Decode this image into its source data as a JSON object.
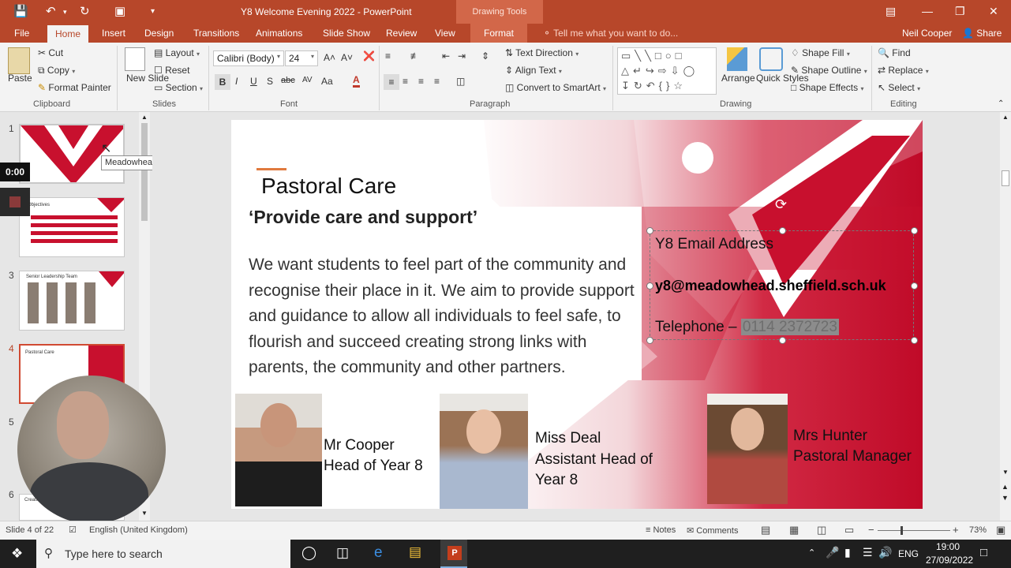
{
  "window": {
    "title": "Y8 Welcome Evening 2022 - PowerPoint",
    "context_tab_group": "Drawing Tools",
    "user": "Neil Cooper",
    "share": "Share"
  },
  "tabs": [
    "File",
    "Home",
    "Insert",
    "Design",
    "Transitions",
    "Animations",
    "Slide Show",
    "Review",
    "View",
    "Format"
  ],
  "tell_me": "Tell me what you want to do...",
  "ribbon": {
    "clipboard": {
      "paste": "Paste",
      "cut": "Cut",
      "copy": "Copy",
      "format_painter": "Format Painter",
      "label": "Clipboard"
    },
    "slides": {
      "new_slide": "New Slide",
      "layout": "Layout",
      "reset": "Reset",
      "section": "Section",
      "label": "Slides"
    },
    "font": {
      "name": "Calibri (Body)",
      "size": "24",
      "label": "Font"
    },
    "paragraph": {
      "text_direction": "Text Direction",
      "align_text": "Align Text",
      "convert": "Convert to SmartArt",
      "label": "Paragraph"
    },
    "drawing": {
      "arrange": "Arrange",
      "quick_styles": "Quick Styles",
      "shape_fill": "Shape Fill",
      "shape_outline": "Shape Outline",
      "shape_effects": "Shape Effects",
      "label": "Drawing"
    },
    "editing": {
      "find": "Find",
      "replace": "Replace",
      "select": "Select",
      "label": "Editing"
    }
  },
  "thumbnails": [
    {
      "num": "1",
      "tooltip": "Meadowhead School Academy..."
    },
    {
      "num": "2",
      "title": "Objectives"
    },
    {
      "num": "3",
      "title": "Senior Leadership Team"
    },
    {
      "num": "4",
      "title": "Pastoral Care"
    },
    {
      "num": "5"
    },
    {
      "num": "6",
      "title": "Creating"
    }
  ],
  "recording": {
    "timer": "0:00"
  },
  "slide": {
    "heading": "Pastoral Care",
    "subheading": "‘Provide care and support’",
    "body": "We want students to feel part of the community and recognise their place in it. We aim to provide support and guidance to allow all individuals to feel safe, to flourish and succeed creating strong links with parents, the community and other partners.",
    "contact": {
      "email_label": "Y8 Email Address",
      "email": "y8@meadowhead.sheffield.sch.uk",
      "phone_label": "Telephone –",
      "phone": "0114 2372723"
    },
    "staff": [
      {
        "name": "Mr Cooper",
        "role": "Head of Year 8"
      },
      {
        "name": "Miss Deal",
        "role": "Assistant Head of Year 8"
      },
      {
        "name": "Mrs Hunter",
        "role": "Pastoral Manager"
      }
    ]
  },
  "status": {
    "slide_info": "Slide 4 of 22",
    "language": "English (United Kingdom)",
    "notes": "Notes",
    "comments": "Comments",
    "zoom": "73%"
  },
  "taskbar": {
    "search_placeholder": "Type here to search",
    "lang": "ENG",
    "time": "19:00",
    "date": "27/09/2022"
  },
  "colors": {
    "accent": "#b7472a",
    "brand_red": "#c8102e"
  }
}
